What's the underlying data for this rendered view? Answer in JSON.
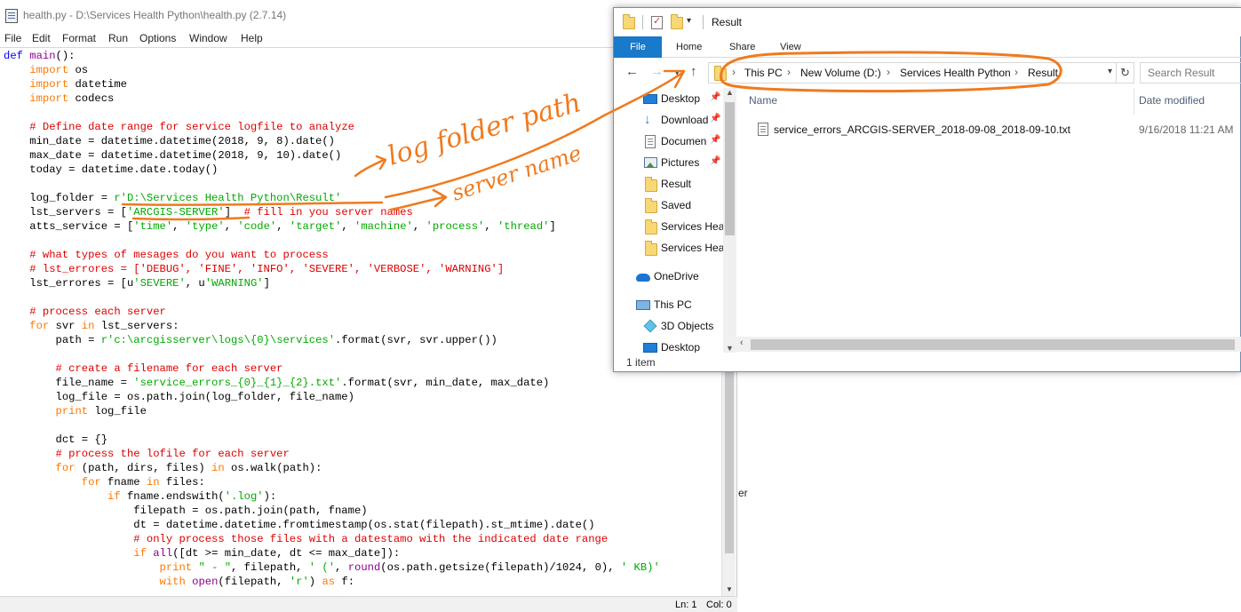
{
  "idle": {
    "title": "health.py - D:\\Services Health Python\\health.py (2.7.14)",
    "menu": [
      "File",
      "Edit",
      "Format",
      "Run",
      "Options",
      "Window",
      "Help"
    ],
    "status": {
      "line": "Ln: 1",
      "col": "Col: 0"
    },
    "code_lines": [
      [
        [
          "df",
          "def "
        ],
        [
          "bi",
          "main"
        ],
        [
          "",
          "():"
        ]
      ],
      [
        [
          "",
          "    "
        ],
        [
          "kw",
          "import"
        ],
        [
          "",
          " os"
        ]
      ],
      [
        [
          "",
          "    "
        ],
        [
          "kw",
          "import"
        ],
        [
          "",
          " datetime"
        ]
      ],
      [
        [
          "",
          "    "
        ],
        [
          "kw",
          "import"
        ],
        [
          "",
          " codecs"
        ]
      ],
      [],
      [
        [
          "",
          "    "
        ],
        [
          "cm",
          "# Define date range for service logfile to analyze"
        ]
      ],
      [
        [
          "",
          "    min_date = datetime.datetime(2018, 9, 8).date()"
        ]
      ],
      [
        [
          "",
          "    max_date = datetime.datetime(2018, 9, 10).date()"
        ]
      ],
      [
        [
          "",
          "    today = datetime.date.today()"
        ]
      ],
      [],
      [
        [
          "",
          "    log_folder = "
        ],
        [
          "st",
          "r'D:\\Services Health Python\\Result'"
        ]
      ],
      [
        [
          "",
          "    lst_servers = ["
        ],
        [
          "st",
          "'ARCGIS-SERVER'"
        ],
        [
          "",
          "]  "
        ],
        [
          "cm",
          "# fill in you server names"
        ]
      ],
      [
        [
          "",
          "    atts_service = ["
        ],
        [
          "st",
          "'time'"
        ],
        [
          ",",
          ", "
        ],
        [
          "st",
          "'type'"
        ],
        [
          ",",
          ", "
        ],
        [
          "st",
          "'code'"
        ],
        [
          ",",
          ", "
        ],
        [
          "st",
          "'target'"
        ],
        [
          ",",
          ", "
        ],
        [
          "st",
          "'machine'"
        ],
        [
          ",",
          ", "
        ],
        [
          "st",
          "'process'"
        ],
        [
          ",",
          ", "
        ],
        [
          "st",
          "'thread'"
        ],
        [
          "",
          "]"
        ]
      ],
      [],
      [
        [
          "",
          "    "
        ],
        [
          "cm",
          "# what types of mesages do you want to process"
        ]
      ],
      [
        [
          "",
          "    "
        ],
        [
          "cm",
          "# lst_errores = ['DEBUG', 'FINE', 'INFO', 'SEVERE', 'VERBOSE', 'WARNING']"
        ]
      ],
      [
        [
          "",
          "    lst_errores = [u"
        ],
        [
          "st",
          "'SEVERE'"
        ],
        [
          "",
          ", u"
        ],
        [
          "st",
          "'WARNING'"
        ],
        [
          "",
          "]"
        ]
      ],
      [],
      [
        [
          "",
          "    "
        ],
        [
          "cm",
          "# process each server"
        ]
      ],
      [
        [
          "",
          "    "
        ],
        [
          "kw",
          "for"
        ],
        [
          "",
          " svr "
        ],
        [
          "kw",
          "in"
        ],
        [
          "",
          " lst_servers:"
        ]
      ],
      [
        [
          "",
          "        path = "
        ],
        [
          "st",
          "r'c:\\arcgisserver\\logs\\{0}\\services'"
        ],
        [
          "",
          ".format(svr, svr.upper())"
        ]
      ],
      [],
      [
        [
          "",
          "        "
        ],
        [
          "cm",
          "# create a filename for each server"
        ]
      ],
      [
        [
          "",
          "        file_name = "
        ],
        [
          "st",
          "'service_errors_{0}_{1}_{2}.txt'"
        ],
        [
          "",
          ".format(svr, min_date, max_date)"
        ]
      ],
      [
        [
          "",
          "        log_file = os.path.join(log_folder, file_name)"
        ]
      ],
      [
        [
          "",
          "        "
        ],
        [
          "kw",
          "print"
        ],
        [
          "",
          " log_file"
        ]
      ],
      [],
      [
        [
          "",
          "        dct = {}"
        ]
      ],
      [
        [
          "",
          "        "
        ],
        [
          "cm",
          "# process the lofile for each server"
        ]
      ],
      [
        [
          "",
          "        "
        ],
        [
          "kw",
          "for"
        ],
        [
          "",
          " (path, dirs, files) "
        ],
        [
          "kw",
          "in"
        ],
        [
          "",
          " os.walk(path):"
        ]
      ],
      [
        [
          "",
          "            "
        ],
        [
          "kw",
          "for"
        ],
        [
          "",
          " fname "
        ],
        [
          "kw",
          "in"
        ],
        [
          "",
          " files:"
        ]
      ],
      [
        [
          "",
          "                "
        ],
        [
          "kw",
          "if"
        ],
        [
          "",
          " fname.endswith("
        ],
        [
          "st",
          "'.log'"
        ],
        [
          "",
          "):"
        ]
      ],
      [
        [
          "",
          "                    filepath = os.path.join(path, fname)"
        ]
      ],
      [
        [
          "",
          "                    dt = datetime.datetime.fromtimestamp(os.stat(filepath).st_mtime).date()"
        ]
      ],
      [
        [
          "",
          "                    "
        ],
        [
          "cm",
          "# only process those files with a datestamo with the indicated date range"
        ]
      ],
      [
        [
          "",
          "                    "
        ],
        [
          "kw",
          "if"
        ],
        [
          "",
          " "
        ],
        [
          "bi",
          "all"
        ],
        [
          "",
          "([dt >= min_date, dt <= max_date]):"
        ]
      ],
      [
        [
          "",
          "                        "
        ],
        [
          "kw",
          "print"
        ],
        [
          "",
          " "
        ],
        [
          "st",
          "\" - \""
        ],
        [
          "",
          ", filepath, "
        ],
        [
          "st",
          "' ('"
        ],
        [
          "",
          ", "
        ],
        [
          "bi",
          "round"
        ],
        [
          "",
          "(os.path.getsize(filepath)/1024, 0), "
        ],
        [
          "st",
          "' KB)'"
        ]
      ],
      [
        [
          "",
          "                        "
        ],
        [
          "kw",
          "with"
        ],
        [
          "",
          " "
        ],
        [
          "bi",
          "open"
        ],
        [
          "",
          "(filepath, "
        ],
        [
          "st",
          "'r'"
        ],
        [
          "",
          ") "
        ],
        [
          "kw",
          "as"
        ],
        [
          "",
          " f:"
        ]
      ]
    ]
  },
  "behind_text": "er",
  "explorer": {
    "title": "Result",
    "ribbon_tabs": [
      "File",
      "Home",
      "Share",
      "View"
    ],
    "breadcrumb": [
      "This PC",
      "New Volume (D:)",
      "Services Health Python",
      "Result"
    ],
    "search_placeholder": "Search Result",
    "nav_items": [
      {
        "label": "Desktop",
        "icon": "desktop-icon",
        "pinned": true
      },
      {
        "label": "Download",
        "icon": "download-icon",
        "pinned": true
      },
      {
        "label": "Documen",
        "icon": "document-icon",
        "pinned": true
      },
      {
        "label": "Pictures",
        "icon": "pictures-icon",
        "pinned": true
      },
      {
        "label": "Result",
        "icon": "folder-icon",
        "pinned": false
      },
      {
        "label": "Saved",
        "icon": "folder-icon",
        "pinned": false
      },
      {
        "label": "Services Heal",
        "icon": "folder-icon",
        "pinned": false
      },
      {
        "label": "Services Heal",
        "icon": "folder-icon",
        "pinned": false
      },
      {
        "label": "OneDrive",
        "icon": "onedrive-icon",
        "pinned": false
      },
      {
        "label": "This PC",
        "icon": "this-pc-icon",
        "pinned": false
      },
      {
        "label": "3D Objects",
        "icon": "3d-objects-icon",
        "pinned": false
      },
      {
        "label": "Desktop",
        "icon": "desktop-icon",
        "pinned": false
      }
    ],
    "columns": {
      "name": "Name",
      "date": "Date modified"
    },
    "files": [
      {
        "name": "service_errors_ARCGIS-SERVER_2018-09-08_2018-09-10.txt",
        "date": "9/16/2018 11:21 AM"
      }
    ],
    "item_count": "1 item"
  },
  "annotations": {
    "color": "#f07a1e",
    "log_folder_path": "log folder path",
    "server_name": "server name"
  }
}
